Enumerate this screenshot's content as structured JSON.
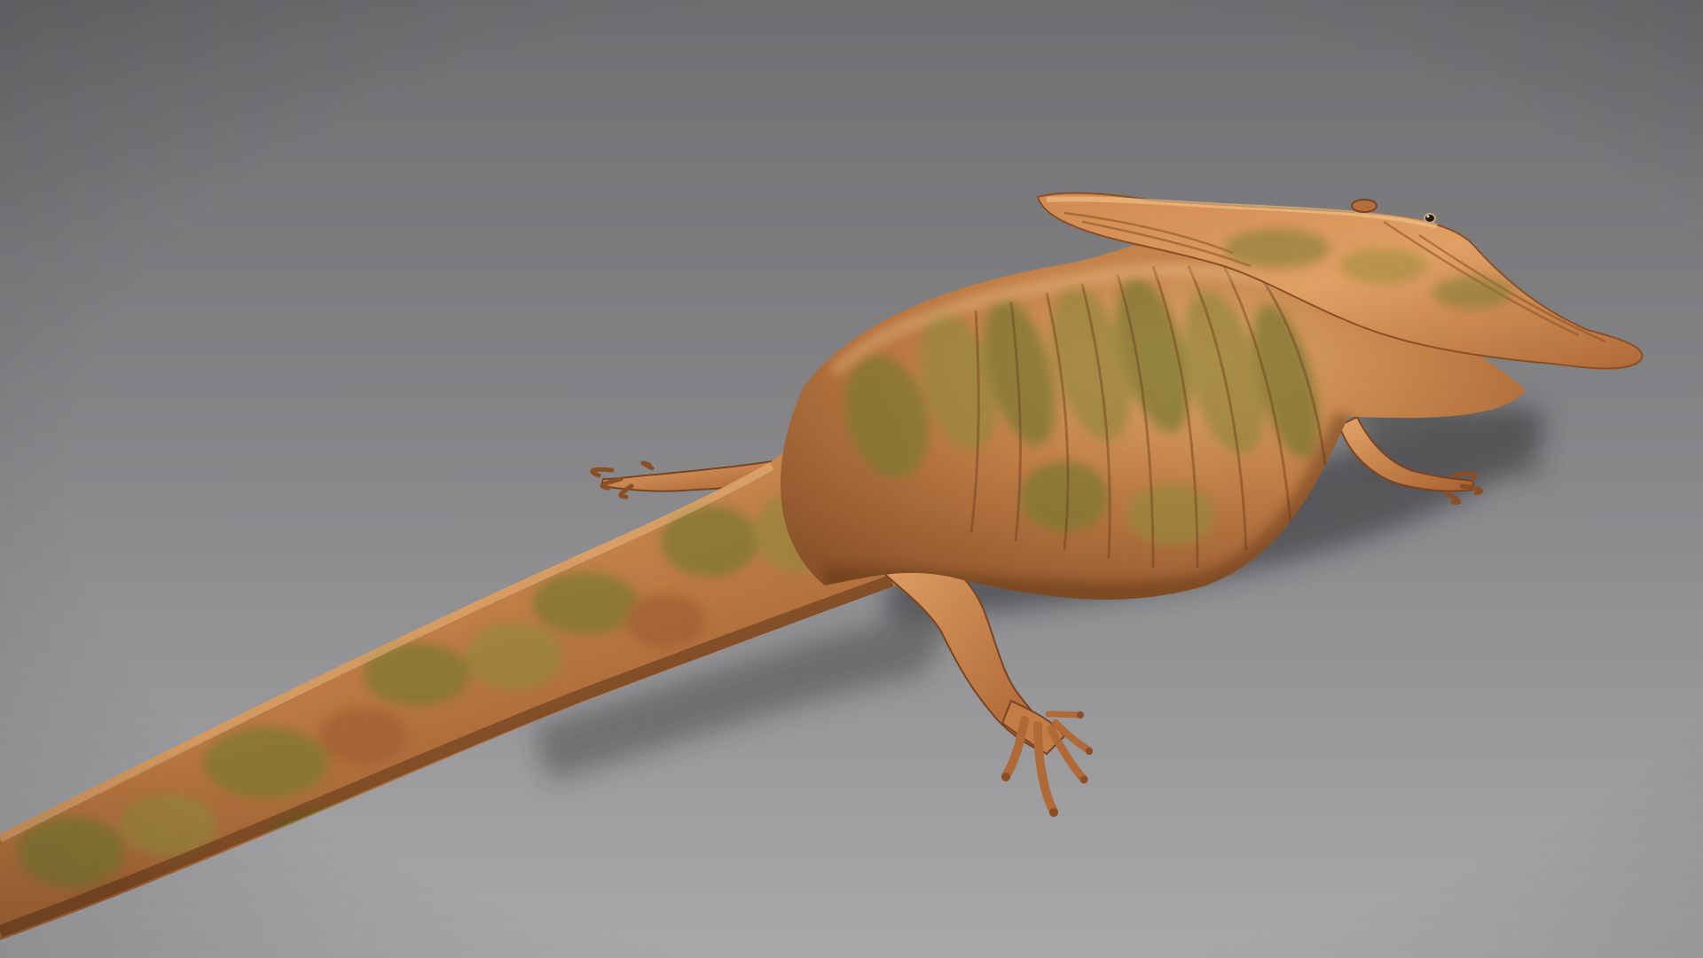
{
  "scene": {
    "subject": "diplocaulus-model",
    "colors": {
      "bg_top": "#6f6f72",
      "bg_mid": "#858588",
      "bg_bottom": "#a9a9ab",
      "skin_base": "#c47c45",
      "skin_light": "#e3a566",
      "skin_dark": "#8a4f27",
      "skin_green": "#7c7a33",
      "skin_olive": "#9a8a3e",
      "shadow": "#2e2e30"
    }
  }
}
